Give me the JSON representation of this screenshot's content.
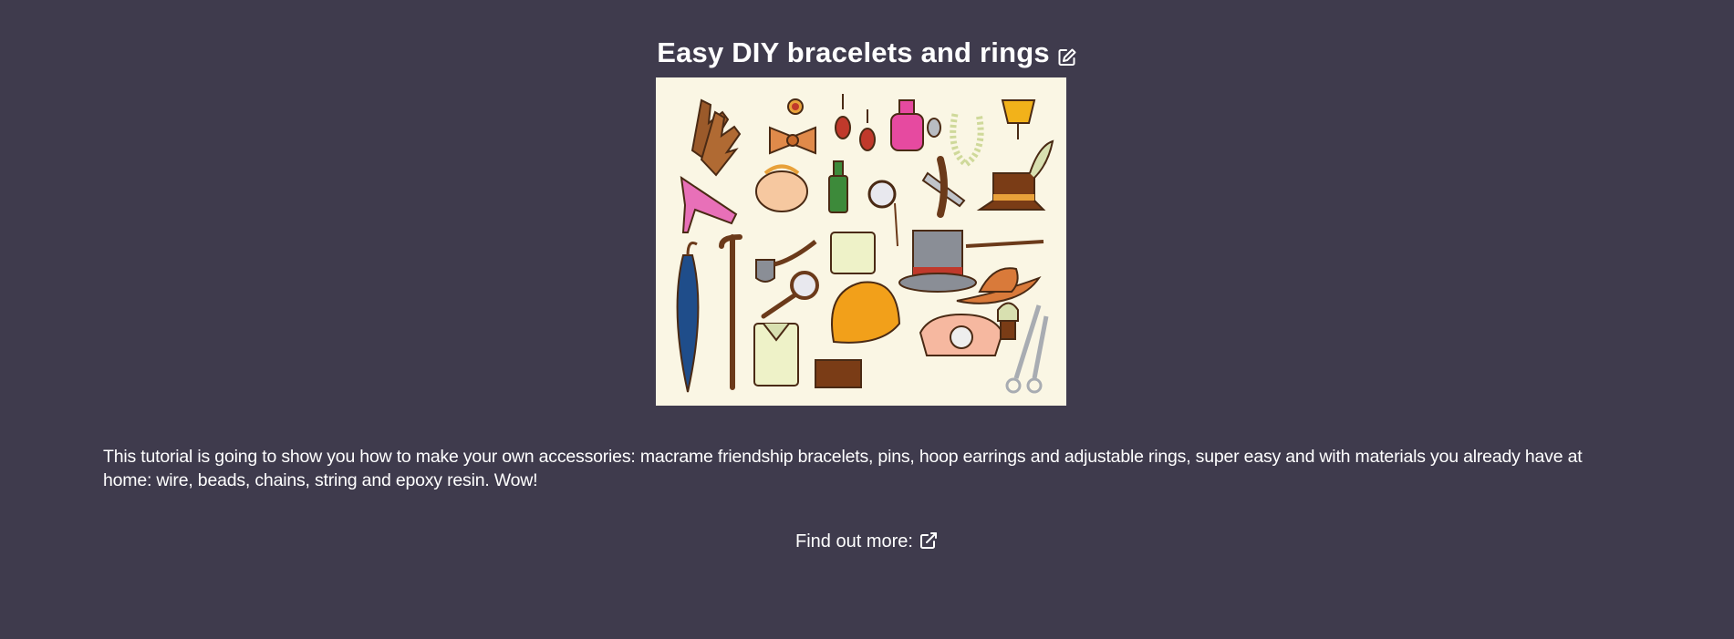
{
  "header": {
    "title": "Easy DIY bracelets and rings",
    "edit_icon": "edit-icon"
  },
  "hero": {
    "icon": "vintage-accessories-illustration"
  },
  "main": {
    "description": "This tutorial is going to show you how to make your own accessories: macrame friendship bracelets, pins, hoop earrings and adjustable rings, super easy and with materials you already have at home: wire, beads, chains, string and epoxy resin. Wow!"
  },
  "footer": {
    "find_more_label": "Find out more:",
    "link_icon": "external-link-icon"
  },
  "colors": {
    "background": "#3f3b4d",
    "text": "#ffffff",
    "hero_background": "#faf6e4"
  }
}
